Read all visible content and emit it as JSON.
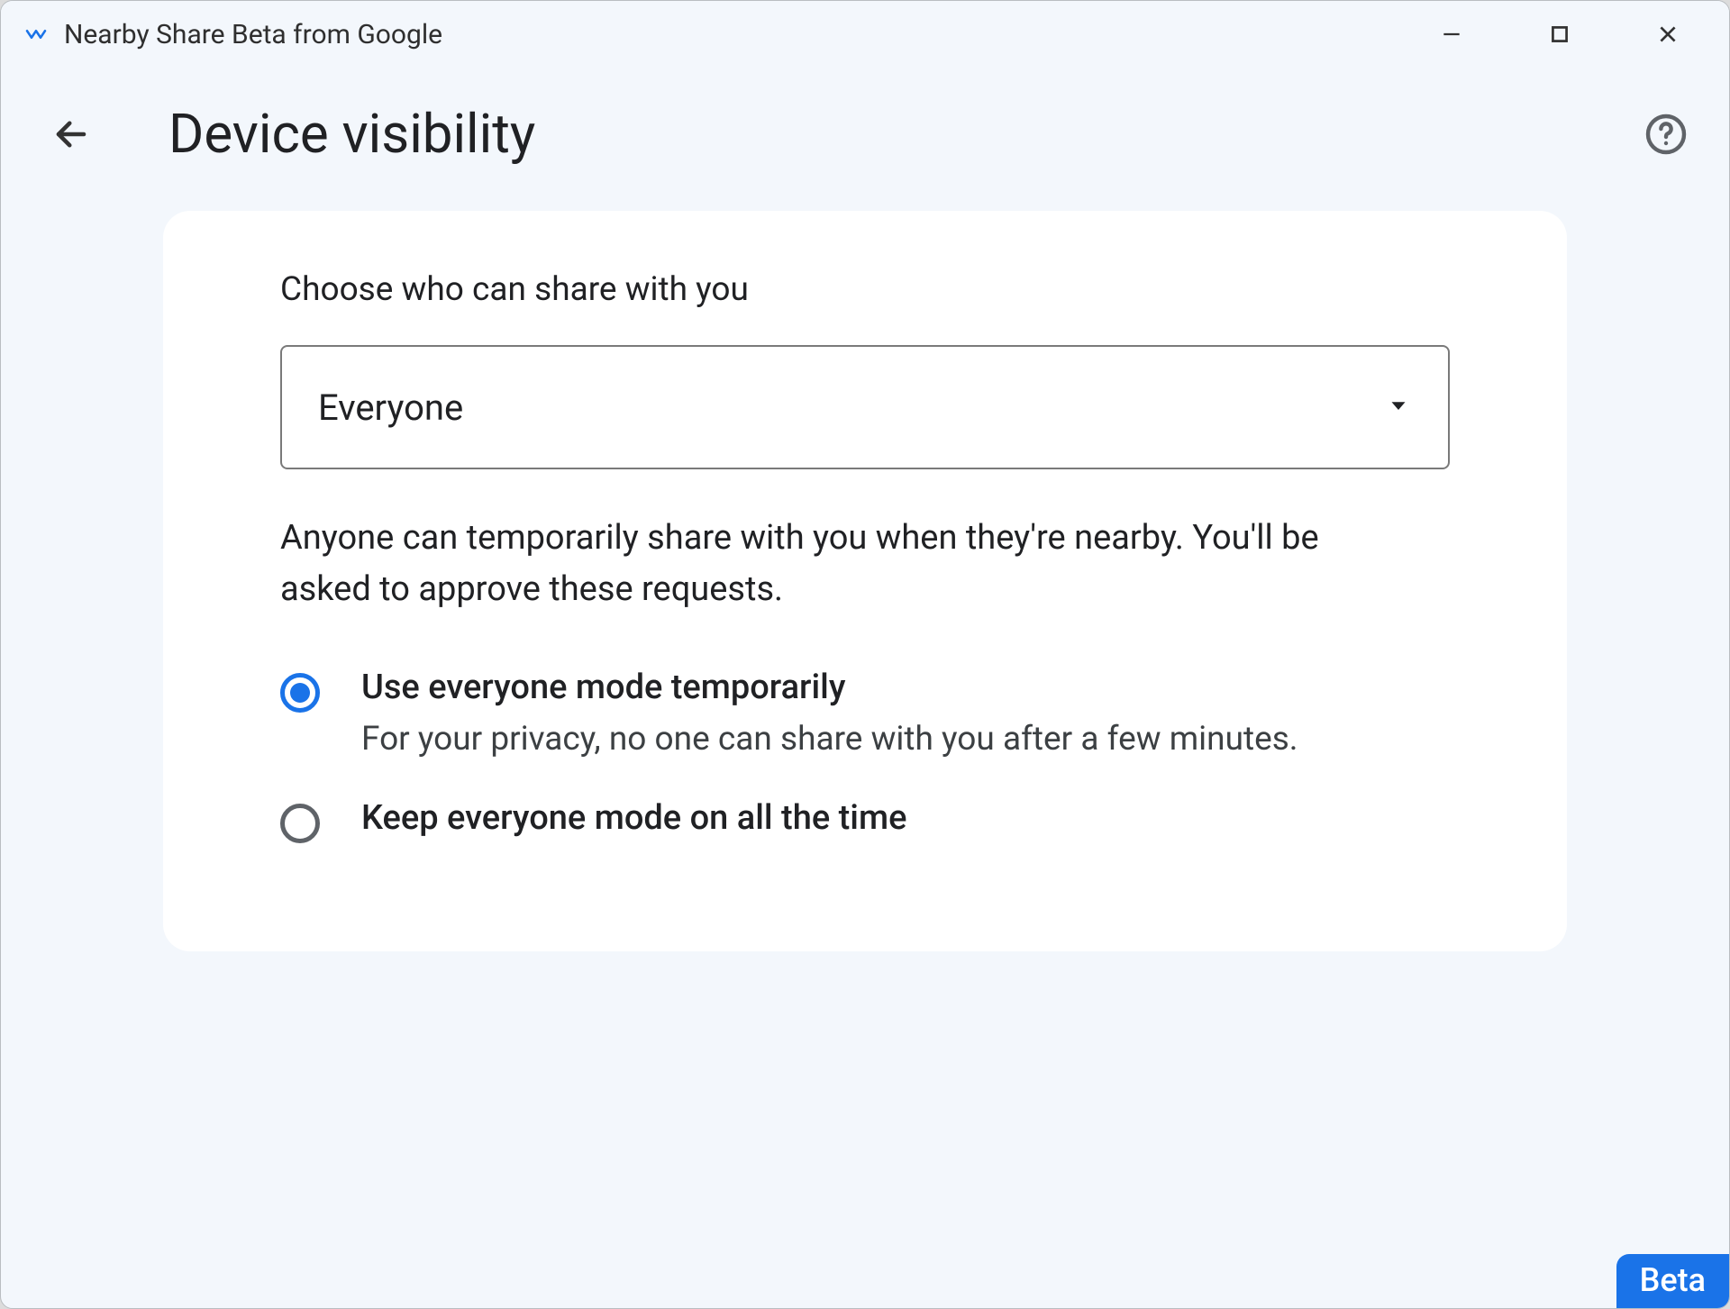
{
  "window": {
    "title": "Nearby Share Beta from Google"
  },
  "header": {
    "page_title": "Device visibility"
  },
  "card": {
    "section_label": "Choose who can share with you",
    "select": {
      "value": "Everyone"
    },
    "description": "Anyone can temporarily share with you when they're nearby. You'll be asked to approve these requests.",
    "radios": [
      {
        "label": "Use everyone mode temporarily",
        "sub": "For your privacy, no one can share with you after a few minutes.",
        "checked": true
      },
      {
        "label": "Keep everyone mode on all the time",
        "sub": "",
        "checked": false
      }
    ]
  },
  "badge": {
    "text": "Beta"
  }
}
